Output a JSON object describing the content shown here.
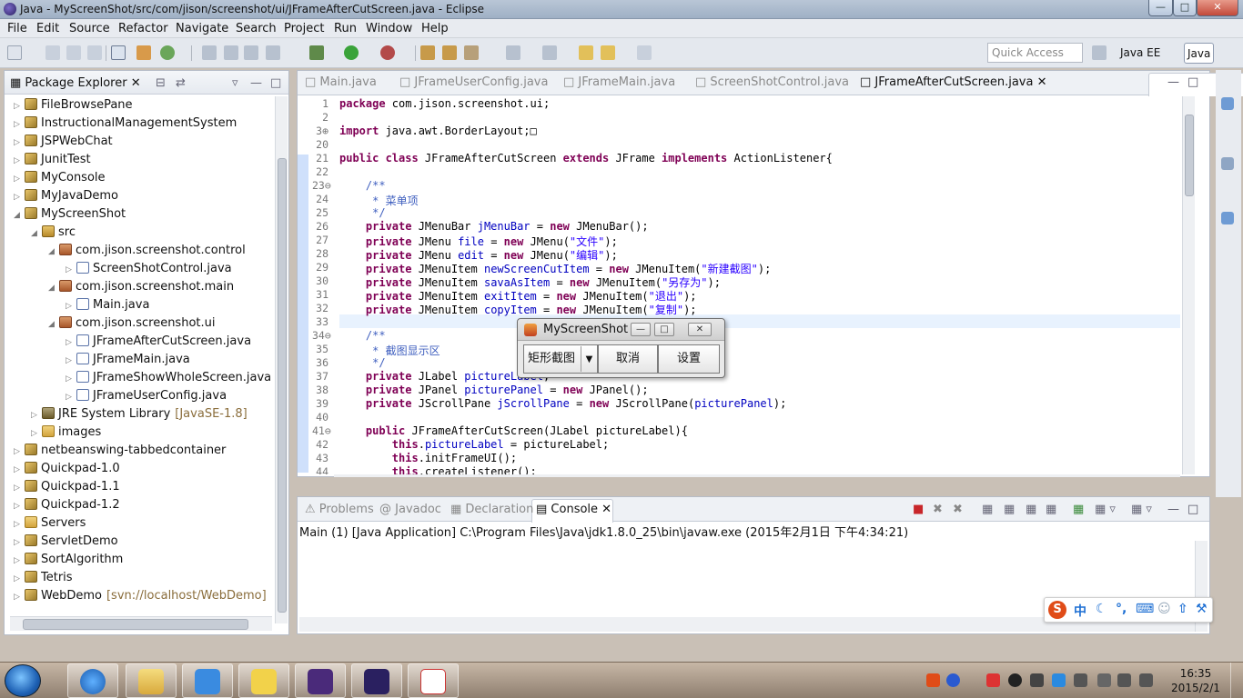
{
  "window": {
    "title": "Java - MyScreenShot/src/com/jison/screenshot/ui/JFrameAfterCutScreen.java - Eclipse",
    "min": "—",
    "max": "□",
    "close": "✕"
  },
  "menubar": [
    "File",
    "Edit",
    "Source",
    "Refactor",
    "Navigate",
    "Search",
    "Project",
    "Run",
    "Window",
    "Help"
  ],
  "toolbar": {
    "quick_access_placeholder": "Quick Access",
    "perspectives": [
      "Java EE",
      "Java"
    ]
  },
  "package_explorer": {
    "title": "Package Explorer",
    "items": [
      {
        "label": "FileBrowsePane",
        "icon": "project",
        "indent": 0,
        "twisty": "▷"
      },
      {
        "label": "InstructionalManagementSystem",
        "icon": "project",
        "indent": 0,
        "twisty": "▷"
      },
      {
        "label": "JSPWebChat",
        "icon": "project",
        "indent": 0,
        "twisty": "▷"
      },
      {
        "label": "JunitTest",
        "icon": "project",
        "indent": 0,
        "twisty": "▷"
      },
      {
        "label": "MyConsole",
        "icon": "project",
        "indent": 0,
        "twisty": "▷"
      },
      {
        "label": "MyJavaDemo",
        "icon": "project",
        "indent": 0,
        "twisty": "▷"
      },
      {
        "label": "MyScreenShot",
        "icon": "project",
        "indent": 0,
        "twisty": "◢"
      },
      {
        "label": "src",
        "icon": "src",
        "indent": 1,
        "twisty": "◢"
      },
      {
        "label": "com.jison.screenshot.control",
        "icon": "package",
        "indent": 2,
        "twisty": "◢"
      },
      {
        "label": "ScreenShotControl.java",
        "icon": "java",
        "indent": 3,
        "twisty": "▷"
      },
      {
        "label": "com.jison.screenshot.main",
        "icon": "package",
        "indent": 2,
        "twisty": "◢"
      },
      {
        "label": "Main.java",
        "icon": "java",
        "indent": 3,
        "twisty": "▷"
      },
      {
        "label": "com.jison.screenshot.ui",
        "icon": "package",
        "indent": 2,
        "twisty": "◢"
      },
      {
        "label": "JFrameAfterCutScreen.java",
        "icon": "java",
        "indent": 3,
        "twisty": "▷"
      },
      {
        "label": "JFrameMain.java",
        "icon": "java",
        "indent": 3,
        "twisty": "▷"
      },
      {
        "label": "JFrameShowWholeScreen.java",
        "icon": "java",
        "indent": 3,
        "twisty": "▷"
      },
      {
        "label": "JFrameUserConfig.java",
        "icon": "java",
        "indent": 3,
        "twisty": "▷"
      },
      {
        "label": "JRE System Library",
        "decoration": "[JavaSE-1.8]",
        "icon": "library",
        "indent": 1,
        "twisty": "▷"
      },
      {
        "label": "images",
        "icon": "folder",
        "indent": 1,
        "twisty": "▷"
      },
      {
        "label": "netbeanswing-tabbedcontainer",
        "icon": "project",
        "indent": 0,
        "twisty": "▷"
      },
      {
        "label": "Quickpad-1.0",
        "icon": "project",
        "indent": 0,
        "twisty": "▷"
      },
      {
        "label": "Quickpad-1.1",
        "icon": "project",
        "indent": 0,
        "twisty": "▷"
      },
      {
        "label": "Quickpad-1.2",
        "icon": "project",
        "indent": 0,
        "twisty": "▷"
      },
      {
        "label": "Servers",
        "icon": "folder",
        "indent": 0,
        "twisty": "▷"
      },
      {
        "label": "ServletDemo",
        "icon": "project",
        "indent": 0,
        "twisty": "▷"
      },
      {
        "label": "SortAlgorithm",
        "icon": "project",
        "indent": 0,
        "twisty": "▷"
      },
      {
        "label": "Tetris",
        "icon": "project",
        "indent": 0,
        "twisty": "▷"
      },
      {
        "label": "WebDemo",
        "decoration": "[svn://localhost/WebDemo]",
        "icon": "project",
        "indent": 0,
        "twisty": "▷"
      }
    ]
  },
  "editor": {
    "tabs": [
      "Main.java",
      "JFrameUserConfig.java",
      "JFrameMain.java",
      "ScreenShotControl.java",
      "JFrameAfterCutScreen.java"
    ],
    "active_tab": "JFrameAfterCutScreen.java",
    "lines": [
      {
        "n": "1",
        "html": "<span class='kw'>package</span> com.jison.screenshot.ui;"
      },
      {
        "n": "2",
        "html": ""
      },
      {
        "n": "3⊕",
        "html": "<span class='kw'>import</span> java.awt.BorderLayout;□"
      },
      {
        "n": "20",
        "html": ""
      },
      {
        "n": "21",
        "html": "<span class='kw'>public class</span> JFrameAfterCutScreen <span class='kw'>extends</span> JFrame <span class='kw'>implements</span> ActionListener{"
      },
      {
        "n": "22",
        "html": ""
      },
      {
        "n": "23⊖",
        "html": "    <span class='jdoc'>/**</span>"
      },
      {
        "n": "24",
        "html": "     <span class='jdoc'>* 菜单项</span>"
      },
      {
        "n": "25",
        "html": "     <span class='jdoc'>*/</span>"
      },
      {
        "n": "26",
        "html": "    <span class='kw'>private</span> JMenuBar <span class='fld'>jMenuBar</span> = <span class='kw'>new</span> JMenuBar();"
      },
      {
        "n": "27",
        "html": "    <span class='kw'>private</span> JMenu <span class='fld'>file</span> = <span class='kw'>new</span> JMenu(<span class='str'>\"文件\"</span>);"
      },
      {
        "n": "28",
        "html": "    <span class='kw'>private</span> JMenu <span class='fld'>edit</span> = <span class='kw'>new</span> JMenu(<span class='str'>\"编辑\"</span>);"
      },
      {
        "n": "29",
        "html": "    <span class='kw'>private</span> JMenuItem <span class='fld'>newScreenCutItem</span> = <span class='kw'>new</span> JMenuItem(<span class='str'>\"新建截图\"</span>);"
      },
      {
        "n": "30",
        "html": "    <span class='kw'>private</span> JMenuItem <span class='fld'>savaAsItem</span> = <span class='kw'>new</span> JMenuItem(<span class='str'>\"另存为\"</span>);"
      },
      {
        "n": "31",
        "html": "    <span class='kw'>private</span> JMenuItem <span class='fld'>exitItem</span> = <span class='kw'>new</span> JMenuItem(<span class='str'>\"退出\"</span>);"
      },
      {
        "n": "32",
        "html": "    <span class='kw'>private</span> JMenuItem <span class='fld'>copyItem</span> = <span class='kw'>new</span> JMenuItem(<span class='str'>\"复制\"</span>);"
      },
      {
        "n": "33",
        "html": ""
      },
      {
        "n": "34⊖",
        "html": "    <span class='jdoc'>/**</span>"
      },
      {
        "n": "35",
        "html": "     <span class='jdoc'>* 截图显示区</span>"
      },
      {
        "n": "36",
        "html": "     <span class='jdoc'>*/</span>"
      },
      {
        "n": "37",
        "html": "    <span class='kw'>private</span> JLabel <span class='fld'>pictureLabel</span>;"
      },
      {
        "n": "38",
        "html": "    <span class='kw'>private</span> JPanel <span class='fld'>picturePanel</span> = <span class='kw'>new</span> JPanel();"
      },
      {
        "n": "39",
        "html": "    <span class='kw'>private</span> JScrollPane <span class='fld'>jScrollPane</span> = <span class='kw'>new</span> JScrollPane(<span class='fld'>picturePanel</span>);"
      },
      {
        "n": "40",
        "html": ""
      },
      {
        "n": "41⊖",
        "html": "    <span class='kw'>public</span> JFrameAfterCutScreen(JLabel pictureLabel){"
      },
      {
        "n": "42",
        "html": "        <span class='kw'>this</span>.<span class='fld'>pictureLabel</span> = pictureLabel;"
      },
      {
        "n": "43",
        "html": "        <span class='kw'>this</span>.initFrameUI();"
      },
      {
        "n": "44",
        "html": "        <span class='kw'>this</span>.createListener();"
      }
    ]
  },
  "console": {
    "tabs": [
      "Problems",
      "Javadoc",
      "Declaration",
      "Console"
    ],
    "active_tab": "Console",
    "launch_info": "Main (1) [Java Application] C:\\Program Files\\Java\\jdk1.8.0_25\\bin\\javaw.exe (2015年2月1日 下午4:34:21)"
  },
  "dialog": {
    "title": "MyScreenShot",
    "combo_value": "矩形截图",
    "cancel_label": "取消",
    "settings_label": "设置"
  },
  "ime": {
    "items": [
      "S",
      "中",
      "☾",
      "°,",
      "⌨",
      "☺",
      "⇧",
      "⚒"
    ]
  },
  "taskbar": {
    "time": "16:35",
    "date": "2015/2/1"
  },
  "colors": {
    "keyword": "#7f0055",
    "field": "#0000c0",
    "string": "#2a00ff",
    "javadoc": "#3f5fbf"
  }
}
